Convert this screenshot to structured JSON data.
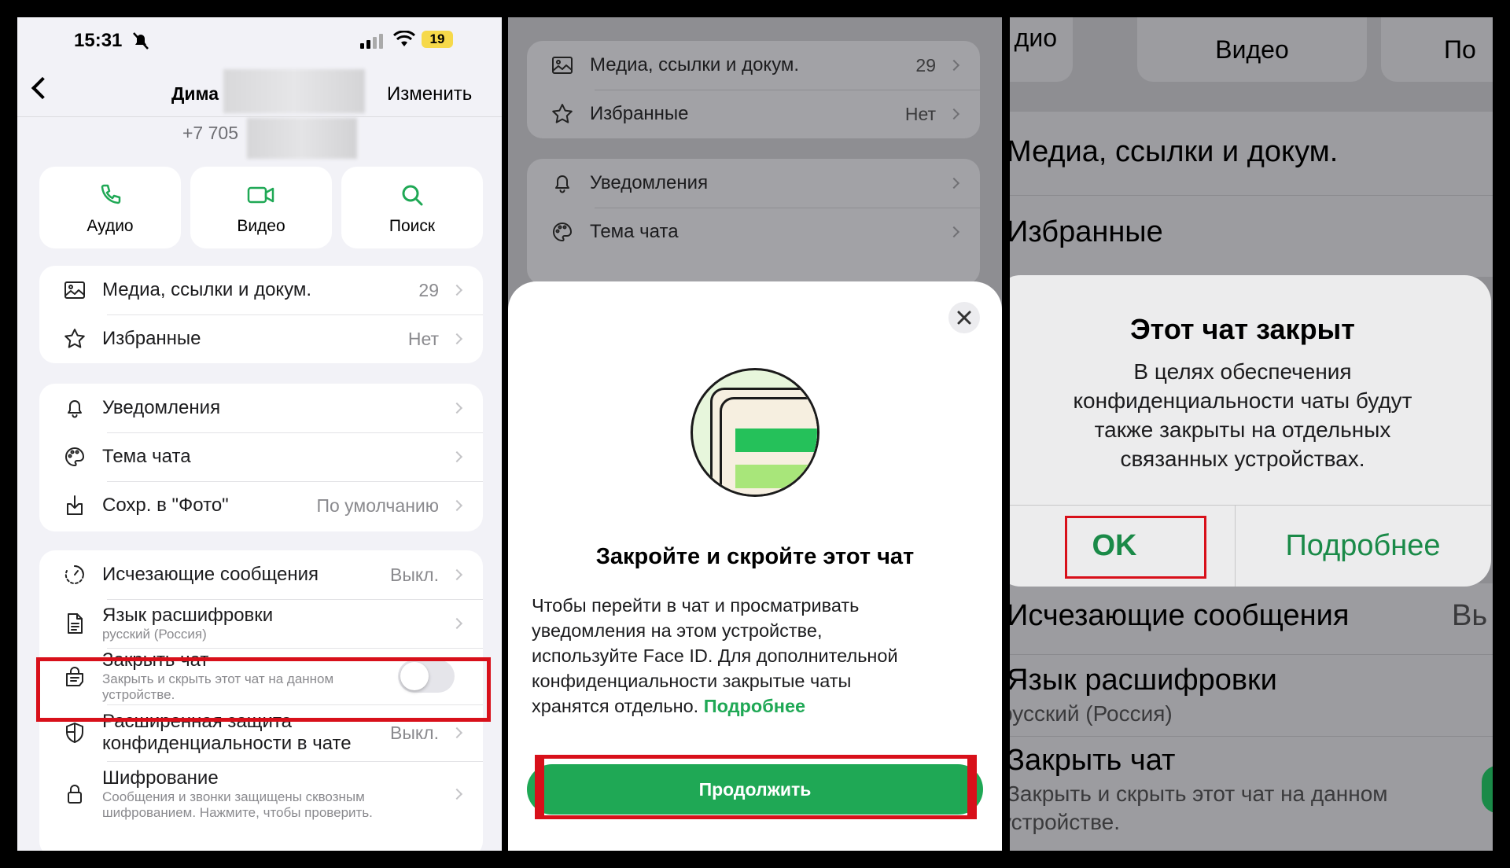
{
  "panel1": {
    "status": {
      "time": "15:31",
      "battery": "19"
    },
    "header": {
      "name": "Дима",
      "edit": "Изменить",
      "phone": "+7 705"
    },
    "actions": [
      {
        "label": "Аудио",
        "icon": "phone-icon"
      },
      {
        "label": "Видео",
        "icon": "video-icon"
      },
      {
        "label": "Поиск",
        "icon": "search-icon"
      }
    ],
    "group1": [
      {
        "label": "Медиа, ссылки и докум.",
        "value": "29",
        "icon": "image-icon"
      },
      {
        "label": "Избранные",
        "value": "Нет",
        "icon": "star-icon"
      }
    ],
    "group2": [
      {
        "label": "Уведомления",
        "value": "",
        "icon": "bell-icon"
      },
      {
        "label": "Тема чата",
        "value": "",
        "icon": "palette-icon"
      },
      {
        "label": "Сохр. в \"Фото\"",
        "value": "По умолчанию",
        "icon": "download-icon"
      }
    ],
    "group3": {
      "disappearing": {
        "label": "Исчезающие сообщения",
        "value": "Выкл."
      },
      "transcript": {
        "label": "Язык расшифровки",
        "sub": "русский (Россия)"
      },
      "lock": {
        "label": "Закрыть чат",
        "sub1": "Закрыть и скрыть этот чат на данном",
        "sub2": "устройстве.",
        "toggle": false
      },
      "advanced": {
        "label1": "Расширенная защита",
        "label2": "конфиденциальности в чате",
        "value": "Выкл."
      },
      "encryption": {
        "label": "Шифрование",
        "sub1": "Сообщения и звонки защищены сквозным",
        "sub2": "шифрованием. Нажмите, чтобы проверить."
      }
    }
  },
  "panel2": {
    "bg": [
      {
        "label": "Медиа, ссылки и докум.",
        "value": "29"
      },
      {
        "label": "Избранные",
        "value": "Нет"
      },
      {
        "label": "Уведомления",
        "value": ""
      },
      {
        "label": "Тема чата",
        "value": ""
      }
    ],
    "sheet": {
      "title": "Закройте и скройте этот чат",
      "body1": "Чтобы перейти в чат и просматривать",
      "body2": "уведомления на этом устройстве,",
      "body3": "используйте Face ID. Для дополнительной",
      "body4": "конфиденциальности закрытые чаты",
      "body5": "хранятся отдельно.",
      "link": "Подробнее",
      "button": "Продолжить"
    }
  },
  "panel3": {
    "tabs": [
      "дио",
      "Видео",
      "По"
    ],
    "rows": {
      "media": "Медиа, ссылки и докум.",
      "fav": "Избранные",
      "disappearing": "Исчезающие сообщения",
      "disappearing_val": "Вь",
      "transcript": "Язык расшифровки",
      "transcript_sub": "русский (Россия)",
      "lock": "Закрыть чат",
      "lock_sub1": "Закрыть и скрыть этот чат на данном",
      "lock_sub2": "устройстве."
    },
    "alert": {
      "title": "Этот чат закрыт",
      "l1": "В целях обеспечения",
      "l2": "конфиденциальности чаты будут",
      "l3": "также закрыты на отдельных",
      "l4": "связанных устройствах.",
      "ok": "OK",
      "more": "Подробнее"
    }
  },
  "colors": {
    "accent": "#1fa855",
    "highlight": "#d8101a"
  }
}
